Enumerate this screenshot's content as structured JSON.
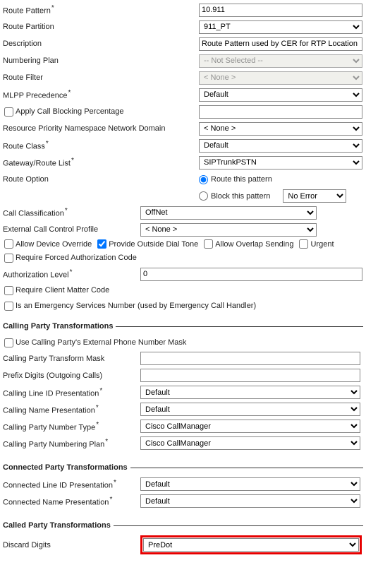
{
  "main": {
    "route_pattern_label": "Route Pattern",
    "route_pattern_value": "10.911",
    "route_partition_label": "Route Partition",
    "route_partition_value": "911_PT",
    "description_label": "Description",
    "description_value": "Route Pattern used by CER for RTP Location",
    "numbering_plan_label": "Numbering Plan",
    "numbering_plan_value": "-- Not Selected --",
    "route_filter_label": "Route Filter",
    "route_filter_value": "< None >",
    "mlpp_label": "MLPP Precedence",
    "mlpp_value": "Default",
    "apply_blocking_label": "Apply Call Blocking Percentage",
    "rp_namespace_label": "Resource Priority Namespace Network Domain",
    "rp_namespace_value": "< None >",
    "route_class_label": "Route Class",
    "route_class_value": "Default",
    "gateway_label": "Gateway/Route List",
    "gateway_value": "SIPTrunkPSTN",
    "route_option_label": "Route Option",
    "route_option_route": "Route this pattern",
    "route_option_block": "Block this pattern",
    "block_error_value": "No Error",
    "call_class_label": "Call Classification",
    "call_class_value": "OffNet",
    "ext_profile_label": "External Call Control Profile",
    "ext_profile_value": "< None >",
    "allow_device_override": "Allow Device Override",
    "provide_outside_dial_tone": "Provide Outside Dial Tone",
    "allow_overlap_sending": "Allow Overlap Sending",
    "urgent": "Urgent",
    "require_forced_auth": "Require Forced Authorization Code",
    "auth_level_label": "Authorization Level",
    "auth_level_value": "0",
    "require_cmc": "Require Client Matter Code",
    "is_emergency": "Is an Emergency Services Number (used by Emergency Call Handler)"
  },
  "calling": {
    "legend": "Calling Party Transformations",
    "use_mask": "Use Calling Party's External Phone Number Mask",
    "transform_mask_label": "Calling Party Transform Mask",
    "transform_mask_value": "",
    "prefix_label": "Prefix Digits (Outgoing Calls)",
    "prefix_value": "",
    "clid_pres_label": "Calling Line ID Presentation",
    "clid_pres_value": "Default",
    "name_pres_label": "Calling Name Presentation",
    "name_pres_value": "Default",
    "num_type_label": "Calling Party Number Type",
    "num_type_value": "Cisco CallManager",
    "num_plan_label": "Calling Party Numbering Plan",
    "num_plan_value": "Cisco CallManager"
  },
  "connected": {
    "legend": "Connected Party Transformations",
    "line_pres_label": "Connected Line ID Presentation",
    "line_pres_value": "Default",
    "name_pres_label": "Connected Name Presentation",
    "name_pres_value": "Default"
  },
  "called": {
    "legend": "Called Party Transformations",
    "discard_label": "Discard Digits",
    "discard_value": "PreDot"
  }
}
